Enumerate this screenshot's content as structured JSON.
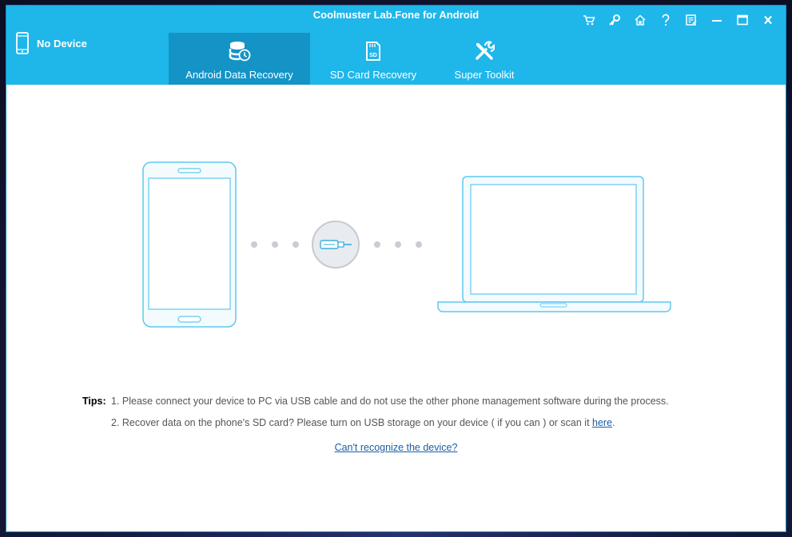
{
  "app": {
    "title": "Coolmuster Lab.Fone for Android"
  },
  "device": {
    "status": "No Device",
    "icon": "phone-icon"
  },
  "window_controls": [
    {
      "name": "cart-icon"
    },
    {
      "name": "key-icon"
    },
    {
      "name": "home-icon"
    },
    {
      "name": "help-icon"
    },
    {
      "name": "feedback-icon"
    },
    {
      "name": "minimize-icon"
    },
    {
      "name": "maximize-icon"
    },
    {
      "name": "close-icon"
    }
  ],
  "tabs": [
    {
      "label": "Android Data Recovery",
      "icon": "database-recovery-icon",
      "active": true
    },
    {
      "label": "SD Card Recovery",
      "icon": "sd-card-icon",
      "active": false
    },
    {
      "label": "Super Toolkit",
      "icon": "tools-icon",
      "active": false
    }
  ],
  "tips": {
    "label": "Tips:",
    "line1": "1. Please connect your device to PC via USB cable and do not use the other phone management software during the process.",
    "line2_text": "2. Recover data on the phone's SD card? Please turn on USB storage on your device ( if you can ) or scan it ",
    "line2_link": "here",
    "line2_end": "."
  },
  "recognize_link": "Can't recognize the device?",
  "colors": {
    "accent": "#1fb6ea",
    "active_tab": "#1493c7",
    "illustration_stroke": "#5ec8f0",
    "dots": "#c9ccd4",
    "link": "#1a5ea8"
  }
}
